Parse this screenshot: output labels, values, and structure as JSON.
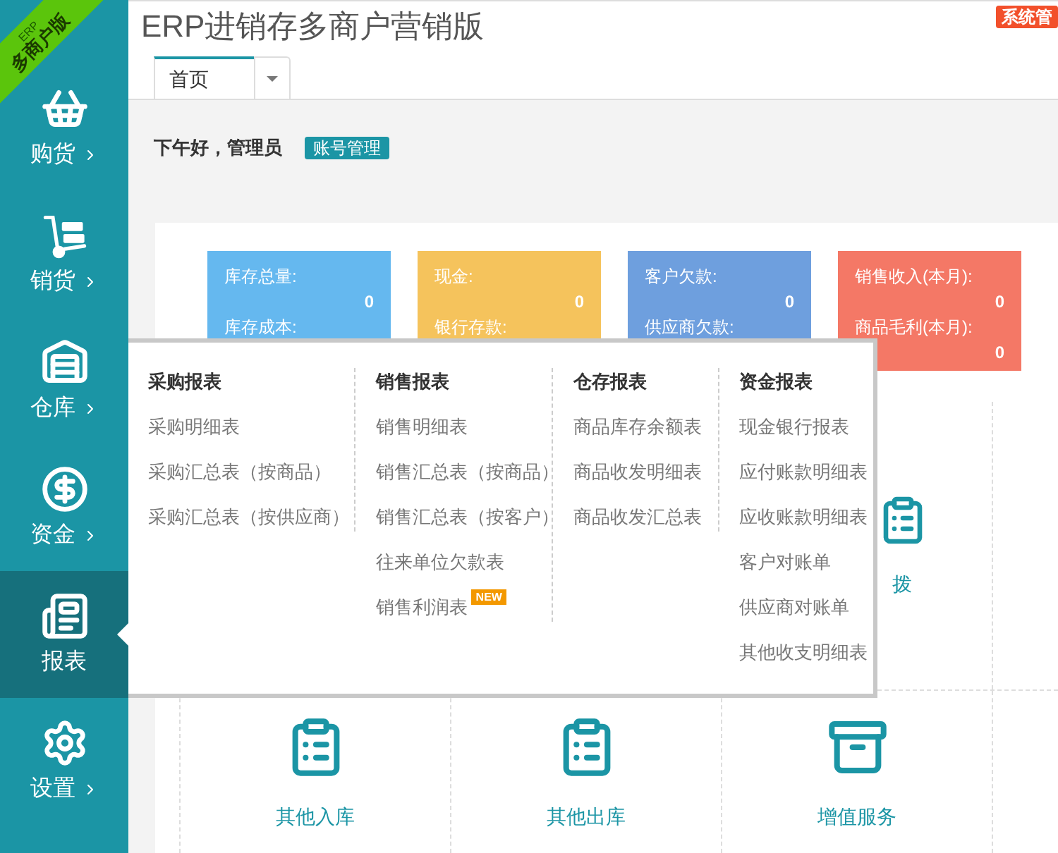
{
  "brand_ribbon": {
    "line_1": "ERP",
    "line_2": "多商户版"
  },
  "sidebar": {
    "items": [
      {
        "label": "购货",
        "selected": false
      },
      {
        "label": "销货",
        "selected": false
      },
      {
        "label": "仓库",
        "selected": false
      },
      {
        "label": "资金",
        "selected": false
      },
      {
        "label": "报表",
        "selected": true
      },
      {
        "label": "设置",
        "selected": false
      }
    ]
  },
  "header": {
    "title": "ERP进销存多商户营销版",
    "admin_button": "系统管"
  },
  "tabs": [
    {
      "label": "首页",
      "selected": true
    }
  ],
  "greeting": {
    "text": "下午好，管理员",
    "account_button": "账号管理"
  },
  "stat_cards": [
    {
      "color": "#65b8ef",
      "fields": [
        {
          "label": "库存总量:",
          "value": "0"
        },
        {
          "label": "库存成本:"
        }
      ]
    },
    {
      "color": "#f5c35c",
      "fields": [
        {
          "label": "现金:",
          "value": "0"
        },
        {
          "label": "银行存款:"
        }
      ]
    },
    {
      "color": "#6e9fde",
      "fields": [
        {
          "label": "客户欠款:",
          "value": "0"
        },
        {
          "label": "供应商欠款:"
        }
      ]
    },
    {
      "color": "#f47866",
      "fields": [
        {
          "label": "销售收入(本月):",
          "value": "0"
        },
        {
          "label": "商品毛利(本月):",
          "value": "0"
        }
      ]
    }
  ],
  "shortcut_rows": [
    [
      null,
      null,
      {
        "label": "拨"
      },
      null
    ],
    [
      {
        "label": "其他入库"
      },
      {
        "label": "其他出库"
      },
      {
        "label": "增值服务"
      },
      null
    ]
  ],
  "report_menu": {
    "columns": [
      {
        "heading": "采购报表",
        "items": [
          {
            "label": "采购明细表"
          },
          {
            "label": "采购汇总表（按商品）"
          },
          {
            "label": "采购汇总表（按供应商）"
          }
        ]
      },
      {
        "heading": "销售报表",
        "items": [
          {
            "label": "销售明细表"
          },
          {
            "label": "销售汇总表（按商品）"
          },
          {
            "label": "销售汇总表（按客户）"
          },
          {
            "label": "往来单位欠款表"
          },
          {
            "label": "销售利润表",
            "badge": "NEW"
          }
        ]
      },
      {
        "heading": "仓存报表",
        "items": [
          {
            "label": "商品库存余额表"
          },
          {
            "label": "商品收发明细表"
          },
          {
            "label": "商品收发汇总表"
          }
        ]
      },
      {
        "heading": "资金报表",
        "items": [
          {
            "label": "现金银行报表"
          },
          {
            "label": "应付账款明细表"
          },
          {
            "label": "应收账款明细表"
          },
          {
            "label": "客户对账单"
          },
          {
            "label": "供应商对账单"
          },
          {
            "label": "其他收支明细表"
          }
        ]
      }
    ]
  }
}
